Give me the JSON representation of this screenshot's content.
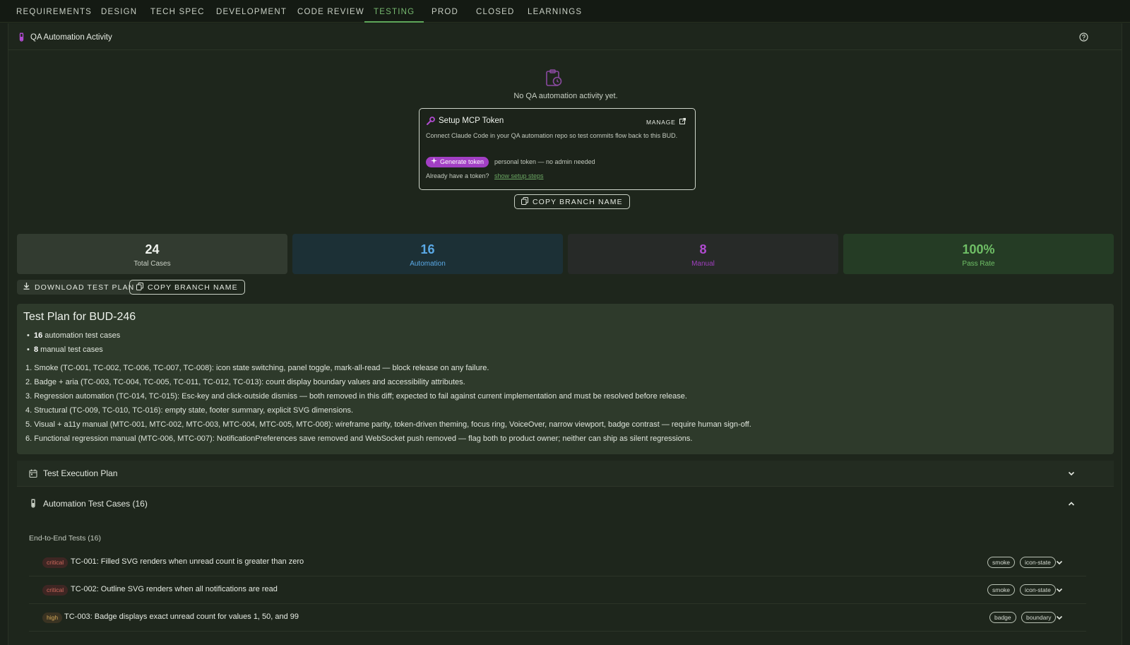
{
  "tabs": [
    "REQUIREMENTS",
    "DESIGN",
    "TECH SPEC",
    "DEVELOPMENT",
    "CODE REVIEW",
    "TESTING",
    "PROD",
    "CLOSED",
    "LEARNINGS"
  ],
  "active_tab": "TESTING",
  "qa_panel": {
    "title": "QA Automation Activity",
    "empty_message": "No QA automation activity yet."
  },
  "mcp": {
    "title": "Setup MCP Token",
    "manage_label": "MANAGE",
    "description": "Connect Claude Code in your QA automation repo so test commits flow back to this BUD.",
    "generate_label": "Generate token",
    "token_note": "personal token — no admin needed",
    "already_text": "Already have a token?",
    "setup_link": "show setup steps",
    "copy_branch_label": "COPY BRANCH NAME"
  },
  "stats": [
    {
      "value": "24",
      "label": "Total Cases"
    },
    {
      "value": "16",
      "label": "Automation"
    },
    {
      "value": "8",
      "label": "Manual"
    },
    {
      "value": "100%",
      "label": "Pass Rate"
    }
  ],
  "actions": {
    "download_label": "DOWNLOAD TEST PLAN",
    "copy_branch_label": "COPY BRANCH NAME"
  },
  "plan": {
    "title": "Test Plan for BUD-246",
    "bullets": [
      {
        "count": "16",
        "text": "automation test cases"
      },
      {
        "count": "8",
        "text": "manual test cases"
      }
    ],
    "items": [
      "1. Smoke (TC-001, TC-002, TC-006, TC-007, TC-008): icon state switching, panel toggle, mark-all-read — block release on any failure.",
      "2. Badge + aria (TC-003, TC-004, TC-005, TC-011, TC-012, TC-013): count display boundary values and accessibility attributes.",
      "3. Regression automation (TC-014, TC-015): Esc-key and click-outside dismiss — both removed in this diff; expected to fail against current implementation and must be resolved before release.",
      "4. Structural (TC-009, TC-010, TC-016): empty state, footer summary, explicit SVG dimensions.",
      "5. Visual + a11y manual (MTC-001, MTC-002, MTC-003, MTC-004, MTC-005, MTC-008): wireframe parity, token-driven theming, focus ring, VoiceOver, narrow viewport, badge contrast — require human sign-off.",
      "6. Functional regression manual (MTC-006, MTC-007): NotificationPreferences save removed and WebSocket push removed — flag both to product owner; neither can ship as silent regressions."
    ]
  },
  "sections": {
    "execution_title": "Test Execution Plan",
    "automation_title": "Automation Test Cases (16)",
    "group_title": "End-to-End Tests (16)"
  },
  "test_cases": [
    {
      "priority": "critical",
      "title": "TC-001: Filled SVG renders when unread count is greater than zero",
      "tags": [
        "smoke",
        "icon-state"
      ]
    },
    {
      "priority": "critical",
      "title": "TC-002: Outline SVG renders when all notifications are read",
      "tags": [
        "smoke",
        "icon-state"
      ]
    },
    {
      "priority": "high",
      "title": "TC-003: Badge displays exact unread count for values 1, 50, and 99",
      "tags": [
        "badge",
        "boundary"
      ]
    }
  ],
  "colors": {
    "accent_green": "#76b86f",
    "automation_blue": "#5aa9e6",
    "manual_purple": "#b04bd0",
    "generate_purple": "#a23fc4",
    "critical_red": "#d06a5d",
    "high_amber": "#d3a857"
  },
  "icons": {
    "qa_panel": "test-tube-icon",
    "help": "help-circle-icon",
    "empty_state": "clipboard-clock-icon",
    "mcp": "wrench-icon",
    "manage": "external-link-icon",
    "copy": "copy-icon",
    "download": "download-icon",
    "execution": "calendar-icon",
    "automation": "test-tube-icon",
    "expand": "chevron-down-icon",
    "collapse": "chevron-up-icon"
  }
}
